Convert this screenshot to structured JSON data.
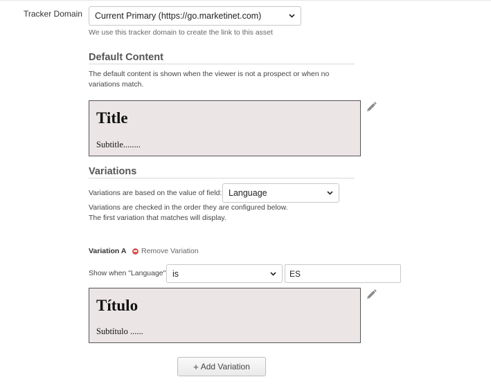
{
  "tracker_domain": {
    "label": "Tracker Domain",
    "selected": "Current Primary (https://go.marketinet.com)",
    "help": "We use this tracker domain to create the link to this asset"
  },
  "default_content": {
    "heading": "Default Content",
    "description_line1": "The default content is shown when the viewer is not a prospect or when no",
    "description_line2": "variations match.",
    "preview_title": "Title",
    "preview_subtitle": "Subtitle........"
  },
  "variations": {
    "heading": "Variations",
    "field_label": "Variations are based on the value of field:",
    "field_selected": "Language",
    "order_note_line1": "Variations are checked in the order they are configured below.",
    "order_note_line2": "The first variation that matches will display."
  },
  "variation_a": {
    "label": "Variation A",
    "remove_label": "Remove Variation",
    "condition_label": "Show when \"Language\"",
    "operator_selected": "is",
    "value": "ES",
    "preview_title": "Título",
    "preview_subtitle": "Subtítulo ......"
  },
  "add_variation_label": "Add Variation",
  "icons": {
    "edit": "pencil-icon",
    "remove": "minus-circle-icon",
    "add": "plus-icon",
    "dropdown": "chevron-down-icon"
  },
  "colors": {
    "preview_bg": "#ebe5e6",
    "remove_icon": "#d9534f"
  }
}
